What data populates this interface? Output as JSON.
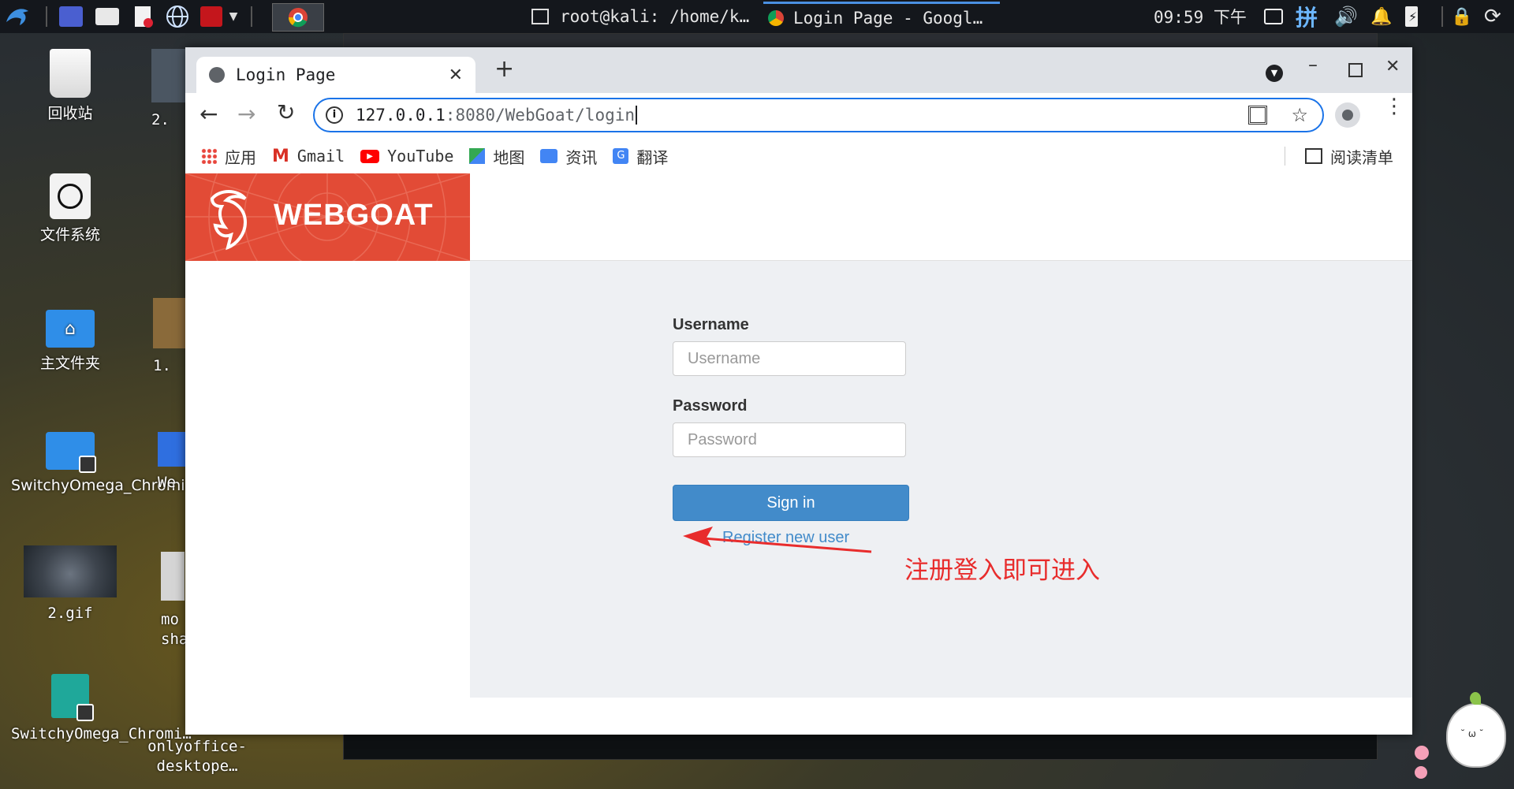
{
  "taskbar": {
    "tasks": [
      {
        "label": "root@kali: /home/k…"
      },
      {
        "label": "Login Page - Googl…"
      }
    ],
    "clock": "09:59 下午",
    "ime": "拼"
  },
  "desktop": {
    "icons": [
      {
        "label": "回收站"
      },
      {
        "label": "文件系统"
      },
      {
        "label": "主文件夹"
      },
      {
        "label": "SwitchyOmega_Chromi…"
      },
      {
        "label": "2.gif"
      },
      {
        "label": "SwitchyOmega_Chromi…"
      },
      {
        "label": "onlyoffice-desktope…"
      }
    ],
    "partial_icons": [
      {
        "label": "2."
      },
      {
        "label": "1."
      },
      {
        "label": "We"
      },
      {
        "label": "mo"
      },
      {
        "label": "shar"
      }
    ]
  },
  "browser": {
    "tab_title": "Login Page",
    "url_host": "127.0.0.1",
    "url_rest": ":8080/WebGoat/login",
    "bookmarks": [
      {
        "label": "应用",
        "icon": "apps-grid-icon"
      },
      {
        "label": "Gmail",
        "icon": "gmail-icon"
      },
      {
        "label": "YouTube",
        "icon": "youtube-icon"
      },
      {
        "label": "地图",
        "icon": "maps-icon"
      },
      {
        "label": "资讯",
        "icon": "news-icon"
      },
      {
        "label": "翻译",
        "icon": "translate-icon"
      }
    ],
    "reading_list": "阅读清单"
  },
  "webgoat": {
    "brand": "WEBGOAT",
    "username_label": "Username",
    "username_placeholder": "Username",
    "password_label": "Password",
    "password_placeholder": "Password",
    "signin_label": "Sign in",
    "register_label": "Register new user"
  },
  "annotation": {
    "text": "注册登入即可进入",
    "color": "#e82c2c"
  },
  "colors": {
    "brand_red": "#e24b36",
    "button_blue": "#428bca",
    "focus_blue": "#1a73e8"
  }
}
